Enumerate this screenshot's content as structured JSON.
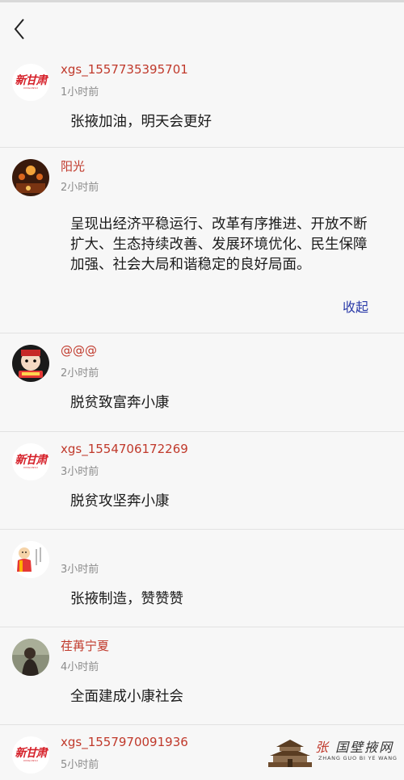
{
  "header": {
    "back_icon": "chevron-left-icon"
  },
  "comments": [
    {
      "username": "xgs_1557735395701",
      "time": "1小时前",
      "content": "张掖加油，明天会更好",
      "avatar": "newspaper-logo"
    },
    {
      "username": "阳光",
      "time": "2小时前",
      "content": "呈现出经济平稳运行、改革有序推进、开放不断扩大、生态持续改善、发展环境优化、民生保障加强、社会大局和谐稳定的良好局面。",
      "collapse_label": "收起",
      "avatar": "photo"
    },
    {
      "username": "@@@",
      "time": "2小时前",
      "content": "脱贫致富奔小康",
      "avatar": "cartoon"
    },
    {
      "username": "xgs_1554706172269",
      "time": "3小时前",
      "content": "脱贫攻坚奔小康",
      "avatar": "newspaper-logo"
    },
    {
      "username": "",
      "time": "3小时前",
      "content": "张掖制造，赞赞赞",
      "avatar": "monk-illustration"
    },
    {
      "username": "荏苒宁夏",
      "time": "4小时前",
      "content": "全面建成小康社会",
      "avatar": "photo"
    },
    {
      "username": "xgs_1557970091936",
      "time": "5小时前",
      "content": "",
      "avatar": "newspaper-logo"
    }
  ],
  "watermark": {
    "name": "张国壁掖网",
    "sub": "ZHANG GUO BI YE WANG"
  },
  "colors": {
    "username": "#c0392b",
    "link": "#2a3aa8",
    "background": "#f7f7f7"
  }
}
